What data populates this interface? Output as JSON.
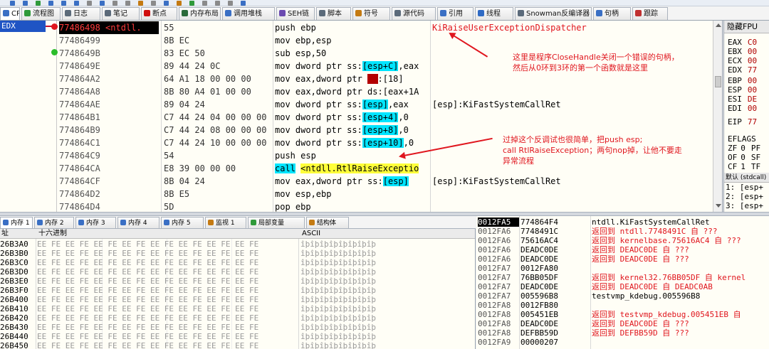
{
  "colors": {
    "accent_red": "#e0161e",
    "selection_cyan": "#00e5ff",
    "call_yellow": "#ffff3a",
    "edx_blue": "#1f54c4"
  },
  "tabs": [
    {
      "label": "CPU",
      "icon": "cpu-icon",
      "color": "#3a6fc4"
    },
    {
      "label": "流程图",
      "icon": "flowchart-icon",
      "color": "#2f9a3a"
    },
    {
      "label": "日志",
      "icon": "log-icon",
      "color": "#5b6a7a"
    },
    {
      "label": "笔记",
      "icon": "notes-icon",
      "color": "#5b6a7a"
    },
    {
      "label": "断点",
      "icon": "breakpoint-icon",
      "color": "#d01010"
    },
    {
      "label": "内存布局",
      "icon": "memory-map-icon",
      "color": "#2a6a3a"
    },
    {
      "label": "调用堆栈",
      "icon": "call-stack-icon",
      "color": "#3a6fc4"
    },
    {
      "label": "SEH链",
      "icon": "seh-icon",
      "color": "#6a4ab0"
    },
    {
      "label": "脚本",
      "icon": "script-icon",
      "color": "#5b6a7a"
    },
    {
      "label": "符号",
      "icon": "symbols-icon",
      "color": "#c47a12"
    },
    {
      "label": "源代码",
      "icon": "source-icon",
      "color": "#5b6a7a"
    },
    {
      "label": "引用",
      "icon": "references-icon",
      "color": "#3a6fc4"
    },
    {
      "label": "线程",
      "icon": "threads-icon",
      "color": "#2f6ac4"
    },
    {
      "label": "Snowman反编译器",
      "icon": "snowman-icon",
      "color": "#5b6a7a"
    },
    {
      "label": "句柄",
      "icon": "handles-icon",
      "color": "#3a6fc4"
    },
    {
      "label": "跟踪",
      "icon": "trace-icon",
      "color": "#c03030"
    }
  ],
  "cpu": {
    "edx_label": "EDX",
    "rows": [
      {
        "addr": "77486498 <ntdll.",
        "hex": "55",
        "dis": "push ebp",
        "cmt": "KiRaiseUserExceptionDispatcher"
      },
      {
        "addr": "77486499",
        "hex": "8B EC",
        "dis": "mov ebp,esp",
        "cmt": ""
      },
      {
        "addr": "7748649B",
        "hex": "83 EC 50",
        "dis": "sub esp,50",
        "cmt": ""
      },
      {
        "addr": "7748649E",
        "hex": "89 44 24 0C",
        "dis_pre": "mov dword ptr ss:",
        "dis_hl": "[esp+C]",
        "dis_post": ",eax",
        "cmt": ""
      },
      {
        "addr": "774864A2",
        "hex": "64 A1 18 00 00 00",
        "dis_pre": "mov eax,dword ptr ",
        "dis_red": "fs",
        "dis_post": ":[18]",
        "cmt": ""
      },
      {
        "addr": "774864A8",
        "hex": "8B 80 A4 01 00 00",
        "dis": "mov eax,dword ptr ds:[eax+1A",
        "cmt": ""
      },
      {
        "addr": "774864AE",
        "hex": "89 04 24",
        "dis_pre": "mov dword ptr ss:",
        "dis_hl": "[esp]",
        "dis_post": ",eax",
        "cmt": "[esp]:KiFastSystemCallRet"
      },
      {
        "addr": "774864B1",
        "hex": "C7 44 24 04 00 00 00",
        "dis_pre": "mov dword ptr ss:",
        "dis_hl": "[esp+4]",
        "dis_post": ",0",
        "cmt": ""
      },
      {
        "addr": "774864B9",
        "hex": "C7 44 24 08 00 00 00",
        "dis_pre": "mov dword ptr ss:",
        "dis_hl": "[esp+8]",
        "dis_post": ",0",
        "cmt": ""
      },
      {
        "addr": "774864C1",
        "hex": "C7 44 24 10 00 00 00",
        "dis_pre": "mov dword ptr ss:",
        "dis_hl": "[esp+10]",
        "dis_post": ",0",
        "cmt": ""
      },
      {
        "addr": "774864C9",
        "hex": "54",
        "dis": "push esp",
        "cmt": ""
      },
      {
        "addr": "774864CA",
        "hex": "E8 39 00 00 00",
        "dis_call": "call",
        "dis_target": "<ntdll.RtlRaiseExceptio",
        "cmt": ""
      },
      {
        "addr": "774864CF",
        "hex": "8B 04 24",
        "dis_pre": "mov eax,dword ptr ss:",
        "dis_hl": "[esp]",
        "dis_post": "",
        "cmt": "[esp]:KiFastSystemCallRet"
      },
      {
        "addr": "774864D2",
        "hex": "8B E5",
        "dis": "mov esp,ebp",
        "cmt": ""
      },
      {
        "addr": "774864D4",
        "hex": "5D",
        "dis": "pop ebp",
        "cmt": ""
      }
    ]
  },
  "annotations": {
    "note1": [
      "这里是程序CloseHandle关闭一个错误的句柄，",
      "然后从0环到3环的第一个函数就是这里"
    ],
    "note2": [
      "过掉这个反调试也很简单，把push esp;",
      "call RtlRaiseException；两句nop掉，让他不要走",
      "异常流程"
    ]
  },
  "registers": {
    "header": "隐藏FPU",
    "items": [
      {
        "name": "EAX",
        "value": "C0"
      },
      {
        "name": "EBX",
        "value": "00"
      },
      {
        "name": "ECX",
        "value": "00"
      },
      {
        "name": "EDX",
        "value": "77"
      },
      {
        "name": "EBP",
        "value": "00"
      },
      {
        "name": "ESP",
        "value": "00"
      },
      {
        "name": "ESI",
        "value": "DE"
      },
      {
        "name": "EDI",
        "value": "00"
      },
      {
        "name": "EIP",
        "value": "77"
      }
    ],
    "eflags_label": "EFLAGS",
    "flags": [
      {
        "name": "ZF",
        "value": "0",
        "extra": "PF"
      },
      {
        "name": "OF",
        "value": "0",
        "extra": "SF"
      },
      {
        "name": "CF",
        "value": "1",
        "extra": "TF"
      }
    ]
  },
  "stack_args": {
    "selector": "默认 (stdcall)",
    "lines": [
      "1: [esp+",
      "2: [esp+",
      "3: [esp+"
    ]
  },
  "dump": {
    "tabs": [
      {
        "label": "内存 1",
        "icon": "memory-icon"
      },
      {
        "label": "内存 2",
        "icon": "memory-icon"
      },
      {
        "label": "内存 3",
        "icon": "memory-icon"
      },
      {
        "label": "内存 4",
        "icon": "memory-icon"
      },
      {
        "label": "内存 5",
        "icon": "memory-icon"
      },
      {
        "label": "监视 1",
        "icon": "watch-icon"
      },
      {
        "label": "局部变量",
        "icon": "locals-icon"
      },
      {
        "label": "结构体",
        "icon": "struct-icon"
      }
    ],
    "col_addr": "址",
    "col_hex": "十六进制",
    "col_ascii": "ASCII",
    "rows": [
      {
        "a": "26B3A0",
        "h": "EE FE EE FE EE FE EE FE EE FE EE FE EE FE EE FE",
        "s": "îþîþîþîþîþîþîþîþ"
      },
      {
        "a": "26B3B0",
        "h": "EE FE EE FE EE FE EE FE EE FE EE FE EE FE EE FE",
        "s": "îþîþîþîþîþîþîþîþ"
      },
      {
        "a": "26B3C0",
        "h": "EE FE EE FE EE FE EE FE EE FE EE FE EE FE EE FE",
        "s": "îþîþîþîþîþîþîþîþ"
      },
      {
        "a": "26B3D0",
        "h": "EE FE EE FE EE FE EE FE EE FE EE FE EE FE EE FE",
        "s": "îþîþîþîþîþîþîþîþ"
      },
      {
        "a": "26B3E0",
        "h": "EE FE EE FE EE FE EE FE EE FE EE FE EE FE EE FE",
        "s": "îþîþîþîþîþîþîþîþ"
      },
      {
        "a": "26B3F0",
        "h": "EE FE EE FE EE FE EE FE EE FE EE FE EE FE EE FE",
        "s": "îþîþîþîþîþîþîþîþ"
      },
      {
        "a": "26B400",
        "h": "EE FE EE FE EE FE EE FE EE FE EE FE EE FE EE FE",
        "s": "îþîþîþîþîþîþîþîþ"
      },
      {
        "a": "26B410",
        "h": "EE FE EE FE EE FE EE FE EE FE EE FE EE FE EE FE",
        "s": "îþîþîþîþîþîþîþîþ"
      },
      {
        "a": "26B420",
        "h": "EE FE EE FE EE FE EE FE EE FE EE FE EE FE EE FE",
        "s": "îþîþîþîþîþîþîþîþ"
      },
      {
        "a": "26B430",
        "h": "EE FE EE FE EE FE EE FE EE FE EE FE EE FE EE FE",
        "s": "îþîþîþîþîþîþîþîþ"
      },
      {
        "a": "26B440",
        "h": "EE FE EE FE EE FE EE FE EE FE EE FE EE FE EE FE",
        "s": "îþîþîþîþîþîþîþîþ"
      },
      {
        "a": "26B450",
        "h": "EE FE EE FE EE FE EE FE EE FE EE FE EE FE EE FE",
        "s": "îþîþîþîþîþîþîþîþ"
      }
    ]
  },
  "stack": {
    "rows": [
      {
        "a": "0012FA5",
        "v": "774864F4",
        "c": "ntdll.KiFastSystemCallRet",
        "plain": true
      },
      {
        "a": "0012FA6",
        "v": "7748491C",
        "c": "返回到 ntdll.7748491C 自 ???"
      },
      {
        "a": "0012FA6",
        "v": "75616AC4",
        "c": "返回到 kernelbase.75616AC4 自 ???"
      },
      {
        "a": "0012FA6",
        "v": "DEADC0DE",
        "c": "返回到 DEADC0DE 自 ???"
      },
      {
        "a": "0012FA6",
        "v": "DEADC0DE",
        "c": "返回到 DEADC0DE 自 ???"
      },
      {
        "a": "0012FA7",
        "v": "0012FA80",
        "c": ""
      },
      {
        "a": "0012FA7",
        "v": "76BB05DF",
        "c": "返回到 kernel32.76BB05DF 自 kernel"
      },
      {
        "a": "0012FA7",
        "v": "DEADC0DE",
        "c": "返回到 DEADC0DE 自 DEADC0AB"
      },
      {
        "a": "0012FA7",
        "v": "005596B8",
        "c": "testvmp_kdebug.005596B8",
        "plain": true
      },
      {
        "a": "0012FA8",
        "v": "0012FB80",
        "c": ""
      },
      {
        "a": "0012FA8",
        "v": "005451EB",
        "c": "返回到 testvmp_kdebug.005451EB 自"
      },
      {
        "a": "0012FA8",
        "v": "DEADC0DE",
        "c": "返回到 DEADC0DE 自 ???"
      },
      {
        "a": "0012FA8",
        "v": "DEFBB59D",
        "c": "返回到 DEFBB59D 自 ???"
      },
      {
        "a": "0012FA9",
        "v": "00000207",
        "c": ""
      }
    ]
  }
}
